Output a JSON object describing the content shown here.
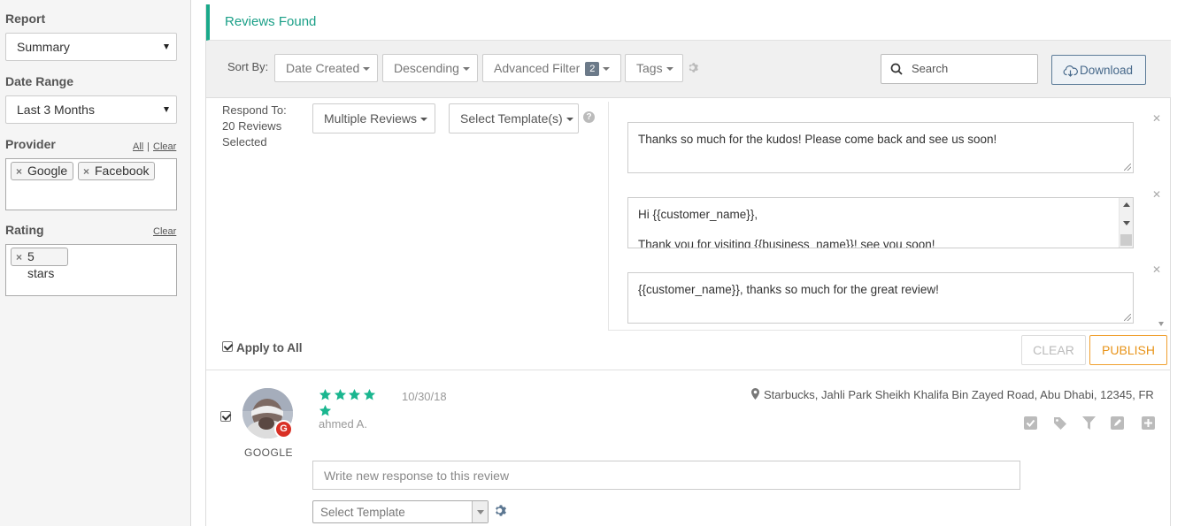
{
  "sidebar": {
    "report_label": "Report",
    "report_value": "Summary",
    "date_range_label": "Date Range",
    "date_range_value": "Last 3 Months",
    "provider_label": "Provider",
    "provider_all": "All",
    "provider_sep": "|",
    "provider_clear": "Clear",
    "providers": [
      "Google",
      "Facebook"
    ],
    "rating_label": "Rating",
    "rating_clear": "Clear",
    "ratings": [
      "5 stars"
    ],
    "chip_remove": "×"
  },
  "header": {
    "title": "Reviews Found"
  },
  "toolbar": {
    "sort_by_label": "Sort By:",
    "sort_field": "Date Created",
    "sort_order": "Descending",
    "advanced_filter": "Advanced Filter",
    "advanced_filter_count": "2",
    "tags": "Tags",
    "search_placeholder": "Search",
    "download": "Download"
  },
  "respond": {
    "label_line1": "Respond To:",
    "label_line2": "20 Reviews",
    "label_line3": "Selected",
    "multiple_reviews": "Multiple Reviews",
    "select_templates": "Select Template(s)",
    "templates": [
      [
        "Thanks so much for the kudos! Please come back and see us soon!"
      ],
      [
        "Hi {{customer_name}},",
        "",
        "Thank you for visiting {{business_name}}! see you soon!"
      ],
      [
        "{{customer_name}}, thanks so much for the great review!"
      ]
    ],
    "apply_to_all": "Apply to All",
    "clear": "CLEAR",
    "publish": "PUBLISH"
  },
  "review": {
    "rating": 5,
    "date": "10/30/18",
    "reviewer": "ahmed A.",
    "provider": "GOOGLE",
    "location": "Starbucks, Jahli Park Sheikh Khalifa Bin Zayed Road, Abu Dhabi, 12345, FR",
    "response_placeholder": "Write new response to this review",
    "select_template": "Select Template",
    "provider_badge": "G"
  },
  "colors": {
    "accent": "#1aa98a",
    "stars": "#1ab68f",
    "publish": "#e8941a",
    "google": "#d93025"
  }
}
